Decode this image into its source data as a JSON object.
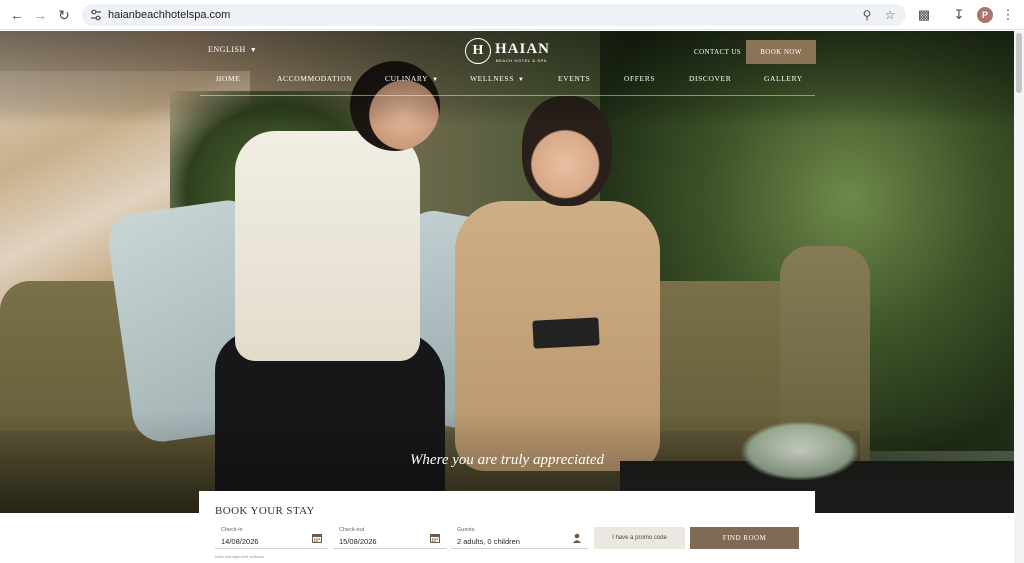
{
  "browser": {
    "url": "haianbeachhotelspa.com",
    "avatar_letter": "P",
    "icons": [
      "back-icon",
      "forward-icon",
      "reload-icon",
      "site-settings-icon",
      "zoom-icon",
      "bookmark-star-icon",
      "extensions-icon",
      "download-icon",
      "more-menu-icon"
    ]
  },
  "header": {
    "language": "ENGLISH",
    "logo_mark": "H",
    "logo_word": "HAIAN",
    "logo_sub": "BEACH HOTEL & SPA",
    "contact_label": "CONTACT US",
    "book_now_label": "BOOK NOW",
    "nav": [
      {
        "label": "HOME",
        "has_dropdown": false
      },
      {
        "label": "ACCOMMODATION",
        "has_dropdown": false
      },
      {
        "label": "CULINARY",
        "has_dropdown": true
      },
      {
        "label": "WELLNESS",
        "has_dropdown": true
      },
      {
        "label": "EVENTS",
        "has_dropdown": false
      },
      {
        "label": "OFFERS",
        "has_dropdown": false
      },
      {
        "label": "DISCOVER",
        "has_dropdown": false
      },
      {
        "label": "GALLERY",
        "has_dropdown": false
      }
    ]
  },
  "hero": {
    "tagline": "Where you are truly appreciated"
  },
  "booking": {
    "title": "BOOK YOUR STAY",
    "checkin": {
      "label": "Check-in",
      "value": "14/08/2026"
    },
    "checkout": {
      "label": "Check-out",
      "value": "15/08/2026"
    },
    "guests": {
      "label": "Guests",
      "value": "2 adults, 0 children"
    },
    "promo_label": "I have a promo code",
    "find_label": "FIND ROOM",
    "footnote": "hotel management software"
  },
  "colors": {
    "accent_brown": "#8b7358",
    "find_button": "#7e6a55",
    "promo_bg": "#ebe8e2"
  }
}
